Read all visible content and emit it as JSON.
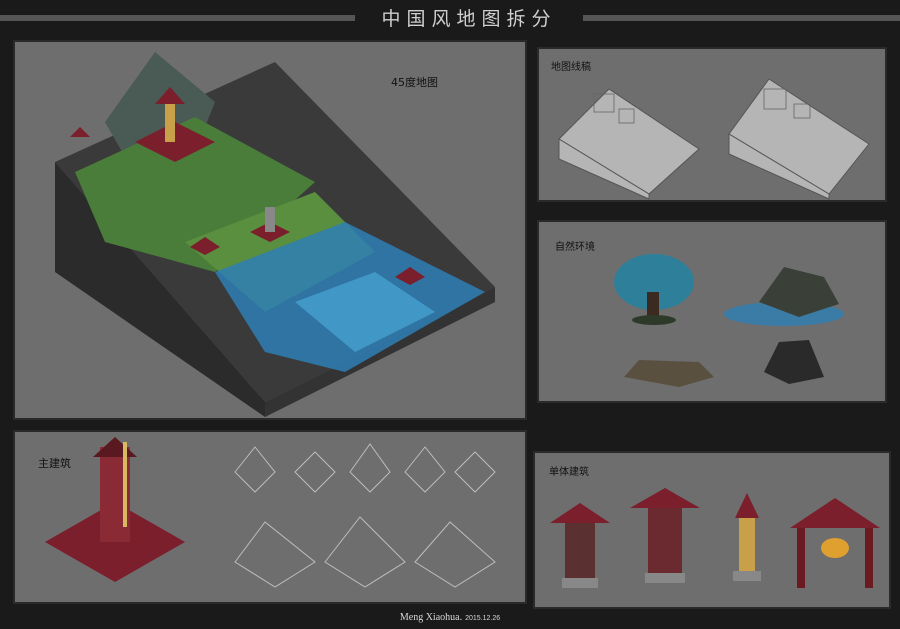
{
  "header": {
    "title": "中国风地图拆分"
  },
  "panels": {
    "map45": {
      "label": "45度地图"
    },
    "lineart": {
      "label": "地图线稿"
    },
    "nature": {
      "label": "自然环境"
    },
    "main_building": {
      "label": "主建筑"
    },
    "single_building": {
      "label": "单体建筑"
    }
  },
  "footer": {
    "author": "Meng Xiaohua.",
    "date": "2015.12.26"
  },
  "colors": {
    "background": "#1a1a1a",
    "panel": "#6e6e6e",
    "roof": "#7a1f2b",
    "grass": "#4a8a3a",
    "water": "#2e7fb5"
  }
}
